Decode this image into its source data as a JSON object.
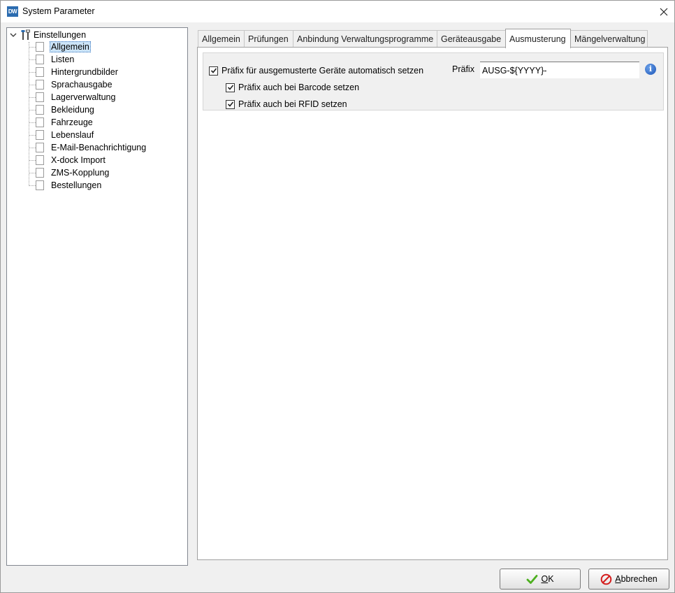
{
  "window": {
    "app_icon_text": "DW",
    "title": "System Parameter"
  },
  "tree": {
    "root": "Einstellungen",
    "items": [
      "Allgemein",
      "Listen",
      "Hintergrundbilder",
      "Sprachausgabe",
      "Lagerverwaltung",
      "Bekleidung",
      "Fahrzeuge",
      "Lebenslauf",
      "E-Mail-Benachrichtigung",
      "X-dock Import",
      "ZMS-Kopplung",
      "Bestellungen"
    ],
    "selected": "Allgemein"
  },
  "tabs": [
    "Allgemein",
    "Prüfungen",
    "Anbindung Verwaltungsprogramme",
    "Geräteausgabe",
    "Ausmusterung",
    "Mängelverwaltung"
  ],
  "active_tab": "Ausmusterung",
  "ausmusterung": {
    "auto_prefix": {
      "label": "Präfix für ausgemusterte Geräte automatisch setzen",
      "checked": true
    },
    "barcode_prefix": {
      "label": "Präfix auch bei Barcode setzen",
      "checked": true
    },
    "rfid_prefix": {
      "label": "Präfix auch bei RFID setzen",
      "checked": true
    },
    "prefix_label": "Präfix",
    "prefix_value": "AUSG-${YYYY}-",
    "info_icon_glyph": "i"
  },
  "buttons": {
    "ok": {
      "accel": "O",
      "rest": "K"
    },
    "cancel": {
      "accel": "A",
      "rest": "bbrechen"
    }
  },
  "colors": {
    "selection": "#cce4f7",
    "ok_icon": "#4caf1e",
    "cancel_icon": "#d41c1c",
    "info_icon": "#1c55b8"
  },
  "icons": {
    "close": "close-icon",
    "tree_expand": "chevron-down-icon",
    "settings": "tools-icon",
    "item": "document-icon",
    "ok": "checkmark-icon",
    "cancel": "no-entry-icon",
    "info": "info-icon"
  }
}
